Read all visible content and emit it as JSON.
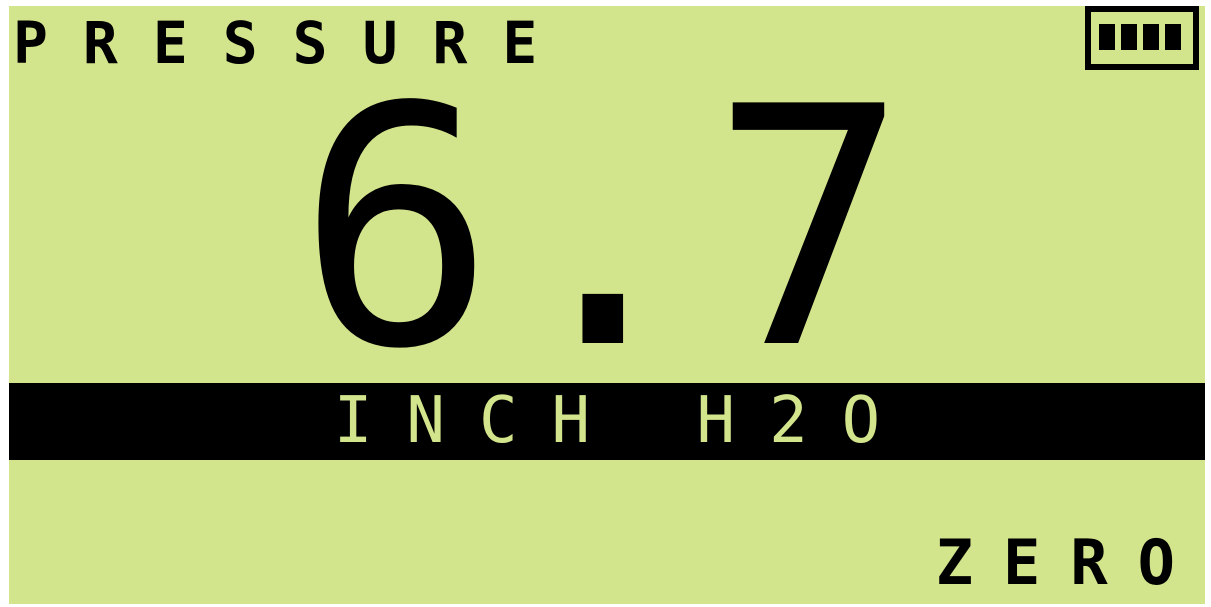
{
  "display": {
    "title": "PRESSURE",
    "reading": "6.7",
    "unit": "INCH H2O",
    "softkey_label": "ZERO",
    "battery": {
      "bars_filled": 4,
      "bars_total": 4
    }
  },
  "colors": {
    "lcd_background": "#d2e48c",
    "lcd_foreground": "#000000"
  }
}
